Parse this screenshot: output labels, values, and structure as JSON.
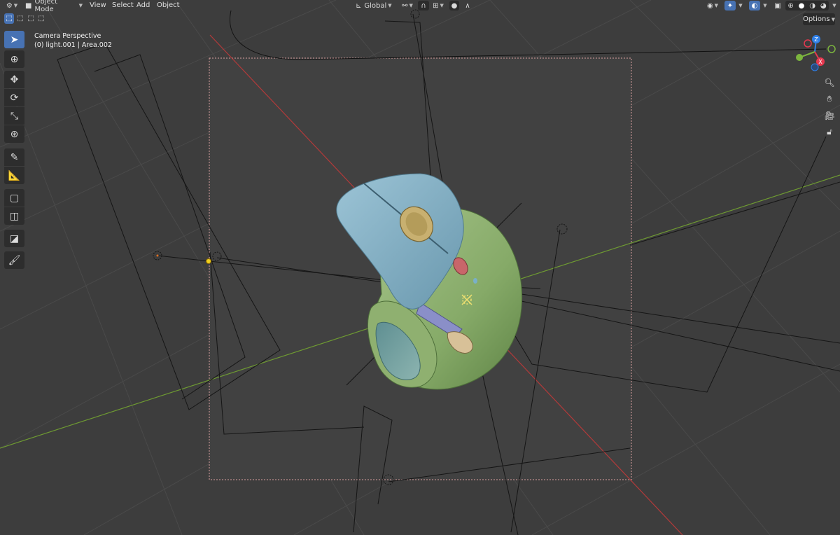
{
  "header": {
    "mode_label": "Object Mode",
    "menus": [
      "View",
      "Select",
      "Add",
      "Object"
    ],
    "transform_orientation": "Global"
  },
  "viewport": {
    "perspective_label": "Camera Perspective",
    "collection_label": "(0) light.001 | Area.002",
    "options_label": "Options"
  },
  "gizmo": {
    "axes": [
      {
        "label": "Z",
        "color": "#2f7fe6"
      },
      {
        "label": "Y",
        "color": "#7cb53e"
      },
      {
        "label": "X",
        "color": "#e6384f"
      }
    ]
  },
  "toolbar": {
    "tools": [
      {
        "name": "select-box-tool",
        "icon": "cursor-arrow-icon"
      },
      {
        "name": "cursor-tool",
        "icon": "3d-cursor-icon"
      },
      {
        "name": "move-tool",
        "icon": "move-arrows-icon"
      },
      {
        "name": "rotate-tool",
        "icon": "rotate-icon"
      },
      {
        "name": "scale-tool",
        "icon": "scale-icon"
      },
      {
        "name": "transform-tool",
        "icon": "transform-icon"
      },
      {
        "name": "annotate-tool",
        "icon": "annotate-pen-icon"
      },
      {
        "name": "measure-tool",
        "icon": "ruler-icon"
      },
      {
        "name": "add-cube-tool",
        "icon": "add-cube-icon"
      },
      {
        "name": "add-object-tool",
        "icon": "add-object-icon"
      },
      {
        "name": "shear-tool",
        "icon": "shear-icon"
      },
      {
        "name": "paint-tool",
        "icon": "brush-icon"
      }
    ]
  },
  "colors": {
    "viewport_bg": "#3d3d3d",
    "camera_frame_bg": "#414141",
    "axis_x": "#b23a3a",
    "axis_y": "#6e9a32",
    "active_blue": "#4772b3",
    "mouse_top": "#7aa8bf",
    "mouse_body": "#8fb070"
  }
}
